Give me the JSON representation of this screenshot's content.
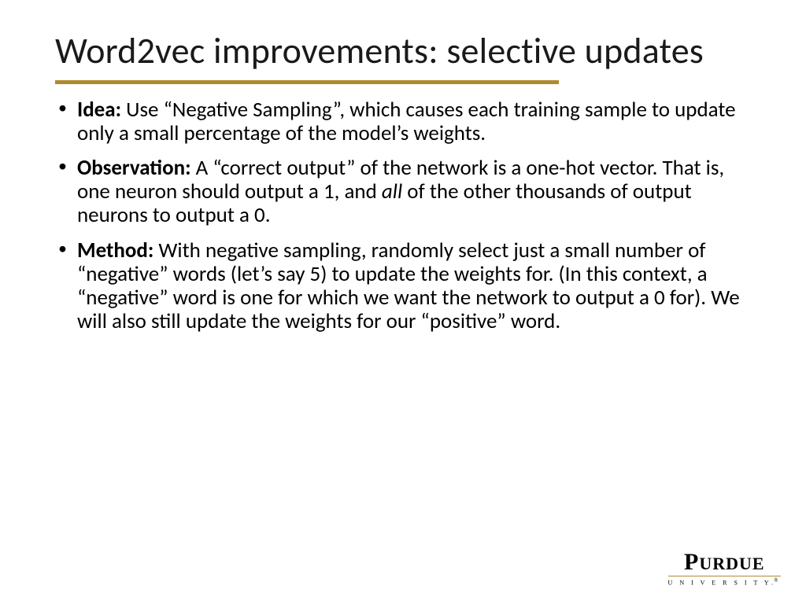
{
  "title": "Word2vec improvements: selective updates",
  "bullets": [
    {
      "label": "Idea:",
      "text": " Use “Negative Sampling”, which causes each training sample to update only a small percentage of the model’s weights."
    },
    {
      "label": "Observation:",
      "pre": " A “correct output” of the network is a one-hot vector. That is, one neuron should output a 1, and ",
      "ital": "all",
      "post": " of the other thousands of output neurons to output a 0."
    },
    {
      "label": "Method:",
      "text": " With negative sampling, randomly select just a small number of “negative” words (let’s say 5) to update the weights for. (In this context, a “negative” word is one for which we want the network to output a 0 for). We will also still update the weights for our “positive” word."
    }
  ],
  "logo": {
    "main": "URDUE",
    "sub": "U N I V E R S I T Y"
  },
  "colors": {
    "accent": "#b08a2e"
  }
}
